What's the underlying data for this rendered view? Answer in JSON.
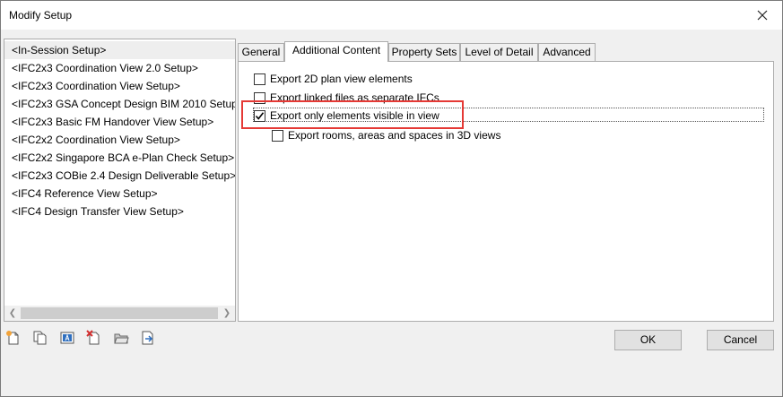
{
  "window": {
    "title": "Modify Setup"
  },
  "setups": [
    "<In-Session Setup>",
    "<IFC2x3 Coordination View 2.0 Setup>",
    "<IFC2x3 Coordination View Setup>",
    "<IFC2x3 GSA Concept Design BIM 2010 Setup>",
    "<IFC2x3 Basic FM Handover View Setup>",
    "<IFC2x2 Coordination View Setup>",
    "<IFC2x2 Singapore BCA e-Plan Check Setup>",
    "<IFC2x3 COBie 2.4 Design Deliverable Setup>",
    "<IFC4 Reference View Setup>",
    "<IFC4 Design Transfer View Setup>"
  ],
  "selected_setup_index": 0,
  "tabs": [
    "General",
    "Additional Content",
    "Property Sets",
    "Level of Detail",
    "Advanced"
  ],
  "active_tab_index": 1,
  "options": [
    {
      "label": "Export 2D plan view elements",
      "checked": false
    },
    {
      "label": "Export linked files as separate IFCs",
      "checked": false
    },
    {
      "label": "Export only elements visible in view",
      "checked": true
    },
    {
      "label": "Export rooms, areas and spaces in 3D views",
      "checked": false
    }
  ],
  "buttons": {
    "ok": "OK",
    "cancel": "Cancel"
  },
  "toolbar_icons": [
    "new-setup-icon",
    "duplicate-setup-icon",
    "rename-setup-icon",
    "delete-setup-icon",
    "import-setup-icon",
    "export-setup-icon"
  ],
  "colors": {
    "highlight": "#e53935",
    "selection": "#eeeeee"
  }
}
